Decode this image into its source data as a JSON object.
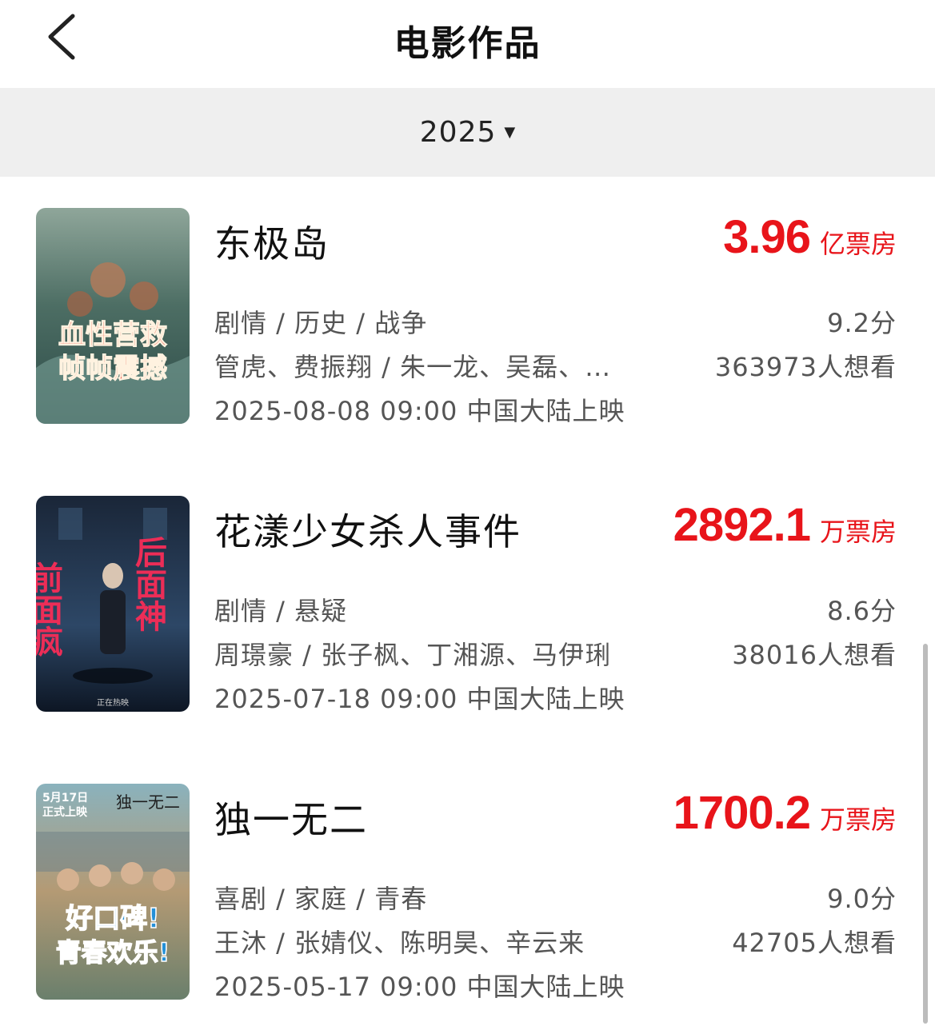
{
  "nav": {
    "title": "电影作品"
  },
  "filter": {
    "year": "2025"
  },
  "movies": [
    {
      "title": "东极岛",
      "box_office": "3.96",
      "box_unit": "亿票房",
      "genre": "剧情 / 历史 / 战争",
      "cast": "管虎、费振翔 / 朱一龙、吴磊、…",
      "release": "2025-08-08 09:00 中国大陆上映",
      "score": "9.2分",
      "wants": "363973人想看",
      "poster": {
        "text": [
          "血性营救",
          "帧帧震撼"
        ],
        "colors": [
          "#2f5a55",
          "#7a8f7d",
          "#c8452f"
        ]
      }
    },
    {
      "title": "花漾少女杀人事件",
      "box_office": "2892.1",
      "box_unit": "万票房",
      "genre": "剧情 / 悬疑",
      "cast": "周璟豪 / 张子枫、丁湘源、马伊琍",
      "release": "2025-07-18 09:00 中国大陆上映",
      "score": "8.6分",
      "wants": "38016人想看",
      "poster": {
        "text": [
          "前面疯",
          "后面神",
          "正在热映"
        ],
        "colors": [
          "#0e1a2c",
          "#223a55",
          "#e1305a"
        ]
      }
    },
    {
      "title": "独一无二",
      "box_office": "1700.2",
      "box_unit": "万票房",
      "genre": "喜剧 / 家庭 / 青春",
      "cast": "王沐 / 张婧仪、陈明昊、辛云来",
      "release": "2025-05-17 09:00 中国大陆上映",
      "score": "9.0分",
      "wants": "42705人想看",
      "poster": {
        "text": [
          "5月17日",
          "正式上映",
          "好口碑!",
          "青春欢乐!",
          "独一无二"
        ],
        "colors": [
          "#5a8a9a",
          "#c9a46a",
          "#1e7fc0"
        ]
      }
    }
  ]
}
